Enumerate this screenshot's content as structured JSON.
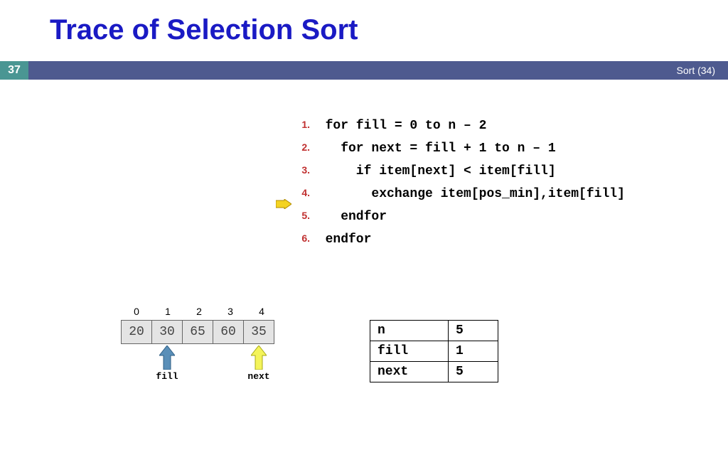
{
  "title": "Trace of Selection Sort",
  "slide_number": "37",
  "header_right": "Sort (34)",
  "code_lines": [
    {
      "n": "1.",
      "text": "  for fill = 0 to n – 2"
    },
    {
      "n": "2.",
      "text": "    for next = fill + 1 to n – 1"
    },
    {
      "n": "3.",
      "text": "      if item[next] < item[fill]"
    },
    {
      "n": "4.",
      "text": "        exchange item[pos_min],item[fill]"
    },
    {
      "n": "5.",
      "text": "    endfor"
    },
    {
      "n": "6.",
      "text": "  endfor"
    }
  ],
  "active_line_index": 4,
  "array_indices": [
    "0",
    "1",
    "2",
    "3",
    "4"
  ],
  "array_values": [
    "20",
    "30",
    "65",
    "60",
    "35"
  ],
  "fill_index": 1,
  "next_index": 4,
  "fill_label": "fill",
  "next_label": "next",
  "vars": [
    {
      "k": "n",
      "v": "5"
    },
    {
      "k": "fill",
      "v": "1"
    },
    {
      "k": "next",
      "v": "5"
    }
  ]
}
